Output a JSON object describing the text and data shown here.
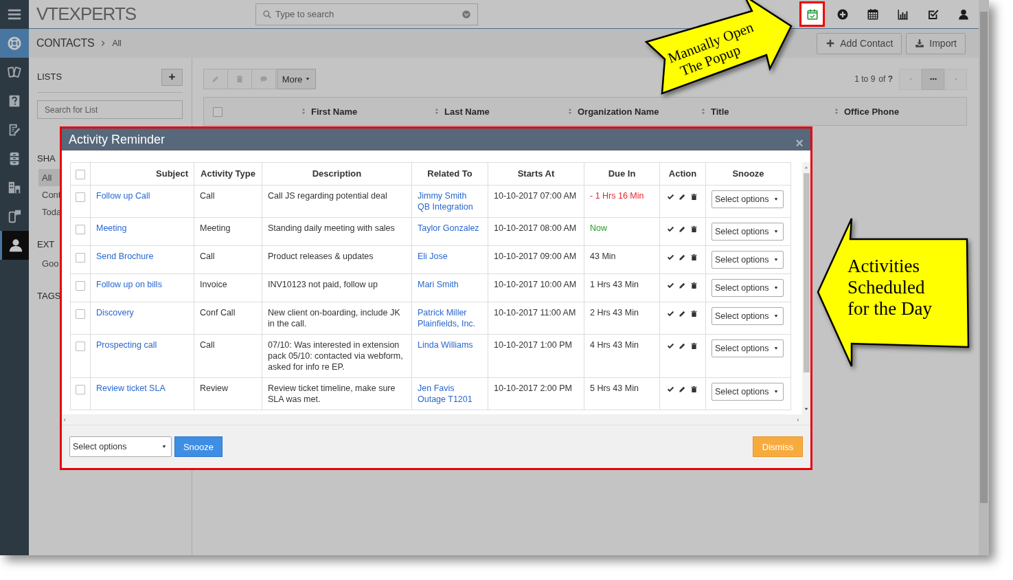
{
  "app": {
    "logo": "VTEXPERTS",
    "search": {
      "placeholder": "Type to search"
    }
  },
  "toolbar_icons": [
    {
      "kind": "reminder",
      "highlighted": true
    },
    {
      "kind": "add",
      "highlighted": false
    },
    {
      "kind": "calendar",
      "highlighted": false
    },
    {
      "kind": "reports",
      "highlighted": false
    },
    {
      "kind": "tasks",
      "highlighted": false
    },
    {
      "kind": "profile",
      "highlighted": false
    }
  ],
  "nav_icons": [
    {
      "kind": "support",
      "selected": false
    },
    {
      "kind": "sales",
      "selected": false
    },
    {
      "kind": "help",
      "selected": false
    },
    {
      "kind": "notes",
      "selected": false
    },
    {
      "kind": "inventory",
      "selected": false
    },
    {
      "kind": "organization",
      "selected": false
    },
    {
      "kind": "mobile",
      "selected": false
    },
    {
      "kind": "contacts",
      "selected": true
    }
  ],
  "breadcrumb": {
    "module": "CONTACTS",
    "view": "All"
  },
  "header_buttons": [
    {
      "kind": "add",
      "label": "Add Contact"
    },
    {
      "kind": "import",
      "label": "Import"
    }
  ],
  "lists_panel": {
    "title": "LISTS",
    "add_label": "+",
    "search_placeholder": "Search for List",
    "sections": [
      {
        "title": "SHA",
        "items": [
          {
            "label": "All",
            "selected": true
          },
          {
            "label": "Cont",
            "selected": false
          },
          {
            "label": "Toda",
            "selected": false
          }
        ]
      },
      {
        "title": "EXT",
        "items": [
          {
            "label": "Goo",
            "selected": false
          }
        ]
      },
      {
        "title": "TAGS"
      }
    ]
  },
  "list_toolbar": {
    "actions": [
      {
        "kind": "edit",
        "disabled": true
      },
      {
        "kind": "delete",
        "disabled": true
      },
      {
        "kind": "comment",
        "disabled": true
      }
    ],
    "more_label": "More",
    "range": "1 to 9",
    "total": "of **?**"
  },
  "table": {
    "select_all_checked": false,
    "columns": [
      "First Name",
      "Last Name",
      "Organization Name",
      "Title",
      "Office Phone"
    ]
  },
  "modal": {
    "title": "Activity Reminder",
    "close": "×",
    "select_all_checked": false,
    "columns": [
      "Subject",
      "Activity Type",
      "Description",
      "Related To",
      "Starts At",
      "Due In",
      "Action",
      "Snooze"
    ],
    "rows": [
      {
        "checked": false,
        "subject": "Follow up Call",
        "type": "Call",
        "description": "Call JS regarding potential deal",
        "related": [
          "Jimmy Smith",
          "QB Integration"
        ],
        "starts": "10-10-2017 07:00 AM",
        "due_in": "- 1 Hrs 16 Min",
        "color": "#e8242c",
        "snooze": "Select options"
      },
      {
        "checked": false,
        "subject": "Meeting",
        "type": "Meeting",
        "description": "Standing daily meeting with sales",
        "related": [
          "Taylor Gonzalez"
        ],
        "starts": "10-10-2017 08:00 AM",
        "due_in": "Now",
        "color": "#2a9a2a",
        "snooze": "Select options"
      },
      {
        "checked": false,
        "subject": "Send Brochure",
        "type": "Call",
        "description": "Product releases & updates",
        "related": [
          "Eli Jose"
        ],
        "starts": "10-10-2017 09:00 AM",
        "due_in": "43 Min",
        "color": "#333333",
        "snooze": "Select options"
      },
      {
        "checked": false,
        "subject": "Follow up on bills",
        "type": "Invoice",
        "description": "INV10123 not paid, follow up",
        "related": [
          "Mari Smith"
        ],
        "starts": "10-10-2017 10:00 AM",
        "due_in": "1 Hrs 43 Min",
        "color": "#333333",
        "snooze": "Select options"
      },
      {
        "checked": false,
        "subject": "Discovery",
        "type": "Conf Call",
        "description": "New client on-boarding, include JK in the call.",
        "related": [
          "Patrick Miller",
          "Plainfields, Inc."
        ],
        "starts": "10-10-2017 11:00 AM",
        "due_in": "2 Hrs 43 Min",
        "color": "#333333",
        "snooze": "Select options"
      },
      {
        "checked": false,
        "subject": "Prospecting call",
        "type": "Call",
        "description": "07/10: Was interested in extension pack 05/10: contacted via webform, asked for info re EP.",
        "related": [
          "Linda Williams"
        ],
        "starts": "10-10-2017 1:00 PM",
        "due_in": "4 Hrs 43 Min",
        "color": "#333333",
        "snooze": "Select options"
      },
      {
        "checked": false,
        "subject": "Review ticket SLA",
        "type": "Review",
        "description": "Review ticket timeline, make sure SLA was met.",
        "related": [
          "Jen Favis",
          "Outage T1201"
        ],
        "starts": "10-10-2017 2:00 PM",
        "due_in": "5 Hrs 43 Min",
        "color": "#333333",
        "snooze": "Select options"
      }
    ],
    "footer": {
      "snooze_select": "Select options",
      "snooze_button": "Snooze",
      "dismiss_button": "Dismiss"
    }
  },
  "callouts": [
    {
      "kind": "right",
      "lines": [
        "Manually Open",
        "The Popup"
      ]
    },
    {
      "kind": "left",
      "lines": [
        "Activities",
        "Scheduled",
        "for the Day"
      ]
    }
  ]
}
